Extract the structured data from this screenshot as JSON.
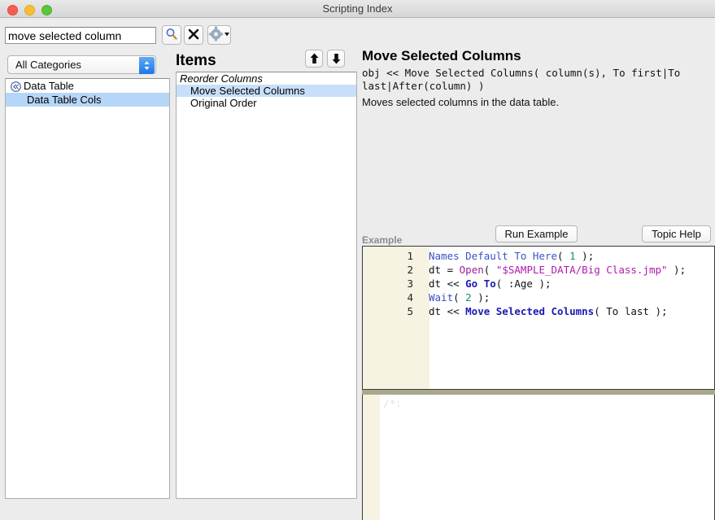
{
  "window": {
    "title": "Scripting Index",
    "traffic_lights": [
      "close",
      "minimize",
      "maximize"
    ]
  },
  "search": {
    "value": "move selected column",
    "placeholder": "",
    "search_icon": "magnifier-icon",
    "clear_icon": "x-icon",
    "options_icon": "gear-icon"
  },
  "category": {
    "selected": "All Categories",
    "options": [
      "All Categories"
    ]
  },
  "tree": {
    "items": [
      {
        "label": "Data Table",
        "icon": "double-chevron-left-icon",
        "level": 0,
        "selected": false
      },
      {
        "label": "Data Table Cols",
        "icon": "",
        "level": 1,
        "selected": true
      }
    ]
  },
  "items_section": {
    "title": "Items",
    "move_up_icon": "arrow-up-icon",
    "move_down_icon": "arrow-down-icon",
    "entries": [
      {
        "label": "Reorder Columns",
        "type": "group",
        "selected": false
      },
      {
        "label": "Move Selected Columns",
        "type": "leaf",
        "selected": true
      },
      {
        "label": "Original Order",
        "type": "leaf",
        "selected": false
      }
    ]
  },
  "detail": {
    "title": "Move Selected Columns",
    "signature": "obj << Move Selected Columns( column(s), To first|To last|After(column) )",
    "description": "Moves selected columns in the data table."
  },
  "example": {
    "label": "Example",
    "run_button": "Run Example",
    "help_button": "Topic Help",
    "lines": [
      {
        "number": "1",
        "tokens": [
          {
            "t": "Names Default To Here",
            "c": "kw"
          },
          {
            "t": "( ",
            "c": "plain"
          },
          {
            "t": "1",
            "c": "num"
          },
          {
            "t": " );",
            "c": "plain"
          }
        ]
      },
      {
        "number": "2",
        "tokens": [
          {
            "t": "dt = ",
            "c": "plain"
          },
          {
            "t": "Open",
            "c": "fn"
          },
          {
            "t": "( ",
            "c": "plain"
          },
          {
            "t": "\"$SAMPLE_DATA/Big Class.jmp\"",
            "c": "str"
          },
          {
            "t": " );",
            "c": "plain"
          }
        ]
      },
      {
        "number": "3",
        "tokens": [
          {
            "t": "dt << ",
            "c": "plain"
          },
          {
            "t": "Go To",
            "c": "msg"
          },
          {
            "t": "( :Age );",
            "c": "plain"
          }
        ]
      },
      {
        "number": "4",
        "tokens": [
          {
            "t": "Wait",
            "c": "kw"
          },
          {
            "t": "( ",
            "c": "plain"
          },
          {
            "t": "2",
            "c": "num"
          },
          {
            "t": " );",
            "c": "plain"
          }
        ]
      },
      {
        "number": "5",
        "tokens": [
          {
            "t": "dt << ",
            "c": "plain"
          },
          {
            "t": "Move Selected Columns",
            "c": "msg"
          },
          {
            "t": "( To last );",
            "c": "plain"
          }
        ]
      }
    ]
  },
  "log": {
    "watermark": "/*:"
  },
  "colors": {
    "selection_blue": "#b6d6f7",
    "item_selection_blue": "#c7dff8",
    "gutter_cream": "#f6f3e2",
    "splitter_olive": "#a9a88a",
    "keyword_blue": "#3a52c8",
    "function_purple": "#9b1f9b",
    "string_magenta": "#b01ab0",
    "number_teal": "#1a8a6e",
    "message_navy": "#1a1ab4"
  }
}
